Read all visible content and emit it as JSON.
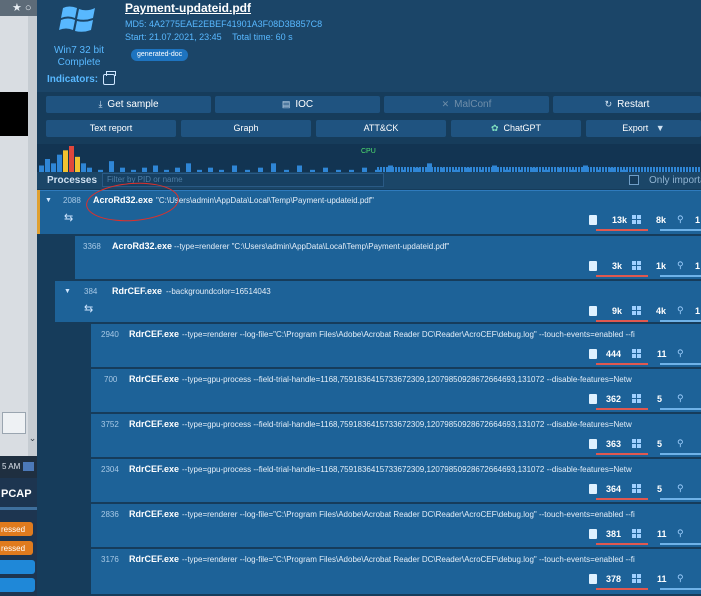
{
  "left_strip": {
    "taskbar_time": "5 AM",
    "pcap_label": "PCAP",
    "badges": [
      "ressed",
      "ressed"
    ]
  },
  "header": {
    "os_name": "Win7 32 bit",
    "os_status": "Complete",
    "indicators_label": "Indicators:",
    "filename": "Payment-updateid.pdf",
    "md5_label": "MD5:",
    "md5_value": "4A2775EAE2EBEF41901A3F08D3B857C8",
    "start_label": "Start:",
    "start_value": "21.07.2021, 23:45",
    "total_time_label": "Total time:",
    "total_time_value": "60 s",
    "tag": "generated-doc"
  },
  "toolbar": {
    "get_sample": "Get sample",
    "ioc": "IOC",
    "malconf": "MalConf",
    "restart": "Restart",
    "text_report": "Text report",
    "graph": "Graph",
    "attck": "ATT&CK",
    "chatgpt": "ChatGPT",
    "export": "Export"
  },
  "cpu_label": "CPU",
  "chart_data": {
    "type": "bar",
    "series": [
      {
        "name": "CPU",
        "values": [
          3,
          6,
          4,
          8,
          10,
          12,
          7,
          4,
          2,
          1,
          5,
          2,
          1,
          2,
          3,
          1,
          2,
          4,
          1,
          2,
          1,
          3,
          1,
          2,
          4,
          1,
          3,
          1,
          2,
          1,
          1,
          2,
          1,
          3,
          1,
          2,
          4,
          2,
          1,
          2,
          1,
          3,
          1,
          1,
          2,
          1,
          2,
          1,
          3,
          1,
          2,
          1
        ]
      }
    ]
  },
  "processes": {
    "title": "Processes",
    "filter_placeholder": "Filter by PID or name",
    "only_important": "Only important",
    "rows": [
      {
        "pid": "2088",
        "name": "AcroRd32.exe",
        "args": "\"C:\\Users\\admin\\AppData\\Local\\Temp\\Payment-updateid.pdf\"",
        "files": "13k",
        "reg": "8k",
        "net": "1"
      },
      {
        "pid": "3368",
        "name": "AcroRd32.exe",
        "args": "--type=renderer \"C:\\Users\\admin\\AppData\\Local\\Temp\\Payment-updateid.pdf\"",
        "files": "3k",
        "reg": "1k",
        "net": "1"
      },
      {
        "pid": "384",
        "name": "RdrCEF.exe",
        "args": "--backgroundcolor=16514043",
        "files": "9k",
        "reg": "4k",
        "net": "1"
      },
      {
        "pid": "2940",
        "name": "RdrCEF.exe",
        "args": "--type=renderer --log-file=\"C:\\Program Files\\Adobe\\Acrobat Reader DC\\Reader\\AcroCEF\\debug.log\" --touch-events=enabled --fi",
        "files": "444",
        "reg": "11",
        "net": ""
      },
      {
        "pid": "700",
        "name": "RdrCEF.exe",
        "args": "--type=gpu-process --field-trial-handle=1168,7591836415733672309,12079850928672664693,131072 --disable-features=Netw",
        "files": "362",
        "reg": "5",
        "net": ""
      },
      {
        "pid": "3752",
        "name": "RdrCEF.exe",
        "args": "--type=gpu-process --field-trial-handle=1168,7591836415733672309,12079850928672664693,131072 --disable-features=Netw",
        "files": "363",
        "reg": "5",
        "net": ""
      },
      {
        "pid": "2304",
        "name": "RdrCEF.exe",
        "args": "--type=gpu-process --field-trial-handle=1168,7591836415733672309,12079850928672664693,131072 --disable-features=Netw",
        "files": "364",
        "reg": "5",
        "net": ""
      },
      {
        "pid": "2836",
        "name": "RdrCEF.exe",
        "args": "--type=renderer --log-file=\"C:\\Program Files\\Adobe\\Acrobat Reader DC\\Reader\\AcroCEF\\debug.log\" --touch-events=enabled --fi",
        "files": "381",
        "reg": "11",
        "net": ""
      },
      {
        "pid": "3176",
        "name": "RdrCEF.exe",
        "args": "--type=renderer --log-file=\"C:\\Program Files\\Adobe\\Acrobat Reader DC\\Reader\\AcroCEF\\debug.log\" --touch-events=enabled --fi",
        "files": "378",
        "reg": "11",
        "net": ""
      }
    ]
  },
  "colors": {
    "background": "#163c5b",
    "row": "#1d6298",
    "accent_blue": "#58b8ff",
    "cpu_bar": "#2f86d6",
    "cpu_peak_red": "#e0473c",
    "cpu_peak_yellow": "#f2c230",
    "annotation_red": "#e0302a"
  }
}
